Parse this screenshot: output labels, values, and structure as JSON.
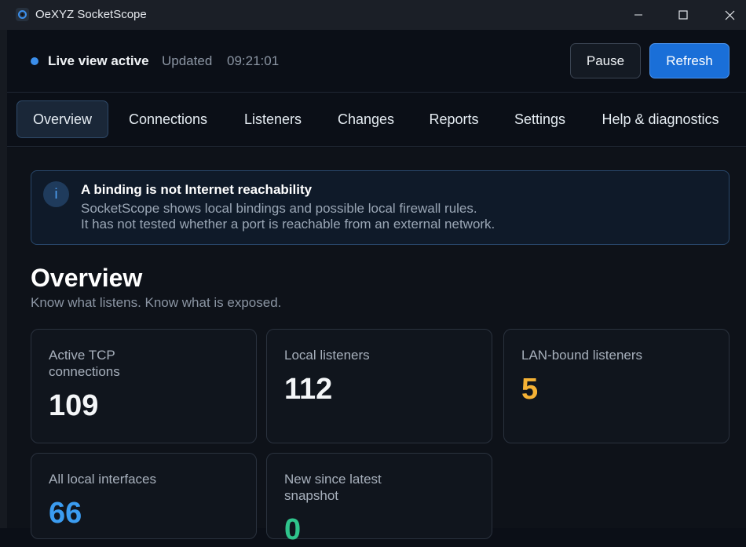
{
  "window": {
    "title": "OeXYZ SocketScope",
    "icons": [
      "app-icon",
      "minimize-icon",
      "maximize-icon",
      "close-icon"
    ]
  },
  "status": {
    "live_label": "Live view active",
    "updated_label": "Updated",
    "updated_time": "09:21:01",
    "live_color": "#3b8eea"
  },
  "actions": {
    "pause_label": "Pause",
    "refresh_label": "Refresh"
  },
  "tabs": [
    {
      "label": "Overview",
      "active": true
    },
    {
      "label": "Connections",
      "active": false
    },
    {
      "label": "Listeners",
      "active": false
    },
    {
      "label": "Changes",
      "active": false
    },
    {
      "label": "Reports",
      "active": false
    },
    {
      "label": "Settings",
      "active": false
    },
    {
      "label": "Help & diagnostics",
      "active": false
    }
  ],
  "info": {
    "icon_glyph": "i",
    "title": "A binding is not Internet reachability",
    "line1": "SocketScope shows local bindings and possible local firewall rules.",
    "line2": "It has not tested whether a port is reachable from an external network."
  },
  "page": {
    "title": "Overview",
    "subtitle": "Know what listens. Know what is exposed."
  },
  "cards": [
    {
      "label": "Active TCP connections",
      "value": "109",
      "color": "#f4f6f8"
    },
    {
      "label": "Local listeners",
      "value": "112",
      "color": "#f4f6f8"
    },
    {
      "label": "LAN-bound listeners",
      "value": "5",
      "color": "#f5b235"
    },
    {
      "label": "All local interfaces",
      "value": "66",
      "color": "#3b9cf0"
    },
    {
      "label": "New since latest snapshot",
      "value": "0",
      "color": "#2fc48c"
    }
  ]
}
